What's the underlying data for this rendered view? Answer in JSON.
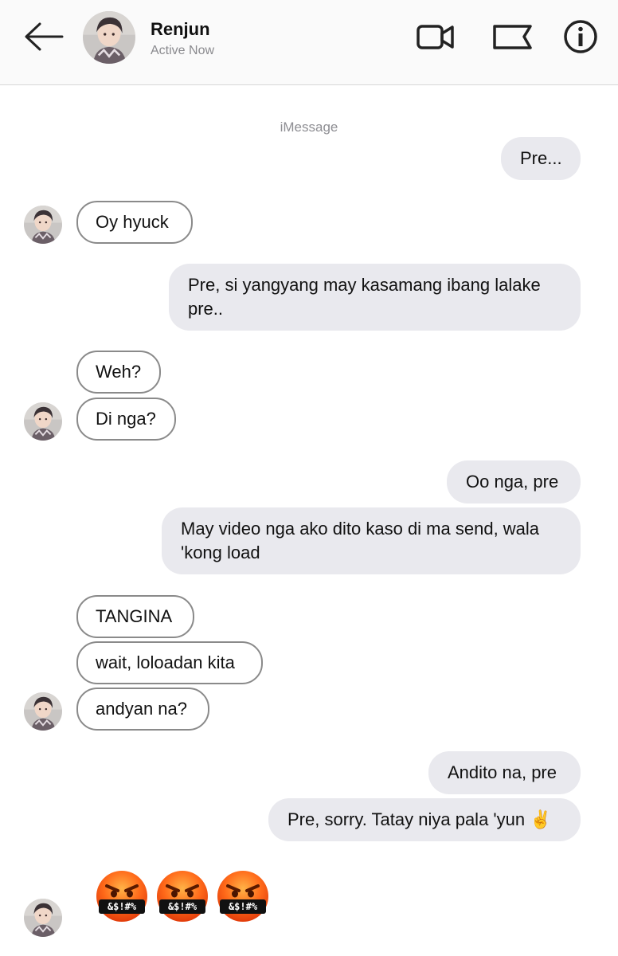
{
  "header": {
    "contact_name": "Renjun",
    "status": "Active Now",
    "icons": [
      "back-arrow-icon",
      "video-camera-icon",
      "flag-icon",
      "info-icon"
    ]
  },
  "service_label": "iMessage",
  "messages": [
    {
      "from": "me",
      "text": "Pre..."
    },
    {
      "from": "them",
      "text": "Oy hyuck"
    },
    {
      "from": "me",
      "text": "Pre, si yangyang may kasamang ibang lalake pre.."
    },
    {
      "from": "them",
      "text": "Weh?"
    },
    {
      "from": "them",
      "text": "Di nga?"
    },
    {
      "from": "me",
      "text": "Oo nga, pre"
    },
    {
      "from": "me",
      "text": "May video nga ako dito kaso di ma send, wala 'kong load"
    },
    {
      "from": "them",
      "text": "TANGINA"
    },
    {
      "from": "them",
      "text": "wait, loloadan kita"
    },
    {
      "from": "them",
      "text": "andyan na?"
    },
    {
      "from": "me",
      "text": "Andito na, pre"
    },
    {
      "from": "me",
      "text": "Pre, sorry. Tatay niya pala 'yun ✌️"
    }
  ],
  "emoji_message": {
    "from": "them",
    "count": 3,
    "emoji": "face-with-symbols-on-mouth",
    "symbol_text": "&$!#%"
  },
  "colors": {
    "sent_bubble": "#e9e9ee",
    "received_border": "#8a8a8a",
    "header_bg": "#fafafa"
  }
}
